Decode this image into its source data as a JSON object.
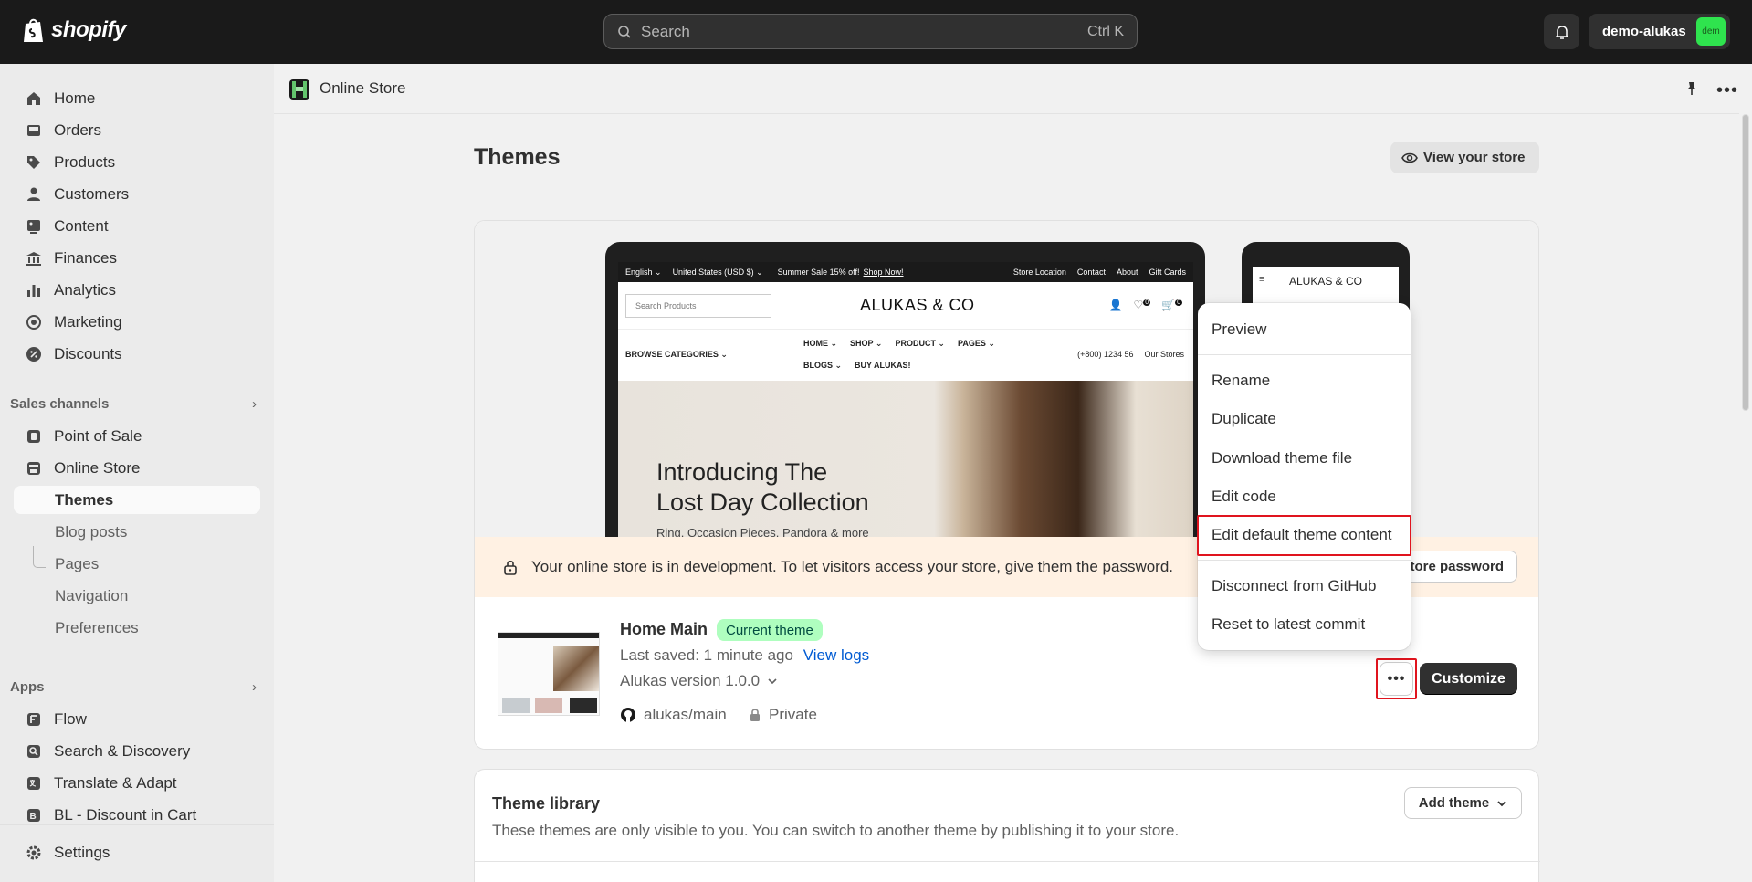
{
  "topbar": {
    "logo_text": "shopify",
    "search_placeholder": "Search",
    "search_shortcut": "Ctrl K",
    "account_name": "demo-alukas",
    "avatar_text": "dem"
  },
  "sidebar": {
    "main_items": [
      {
        "label": "Home",
        "icon": "home-icon"
      },
      {
        "label": "Orders",
        "icon": "inbox-icon"
      },
      {
        "label": "Products",
        "icon": "tag-icon"
      },
      {
        "label": "Customers",
        "icon": "person-icon"
      },
      {
        "label": "Content",
        "icon": "content-icon"
      },
      {
        "label": "Finances",
        "icon": "bank-icon"
      },
      {
        "label": "Analytics",
        "icon": "bar-chart-icon"
      },
      {
        "label": "Marketing",
        "icon": "target-icon"
      },
      {
        "label": "Discounts",
        "icon": "discount-icon"
      }
    ],
    "sales_channels_title": "Sales channels",
    "sales_channels": [
      {
        "label": "Point of Sale",
        "icon": "pos-icon"
      },
      {
        "label": "Online Store",
        "icon": "store-icon"
      }
    ],
    "online_store_sub": [
      {
        "label": "Themes",
        "active": true
      },
      {
        "label": "Blog posts"
      },
      {
        "label": "Pages"
      },
      {
        "label": "Navigation"
      },
      {
        "label": "Preferences"
      }
    ],
    "apps_title": "Apps",
    "apps": [
      {
        "label": "Flow",
        "icon": "flow-icon"
      },
      {
        "label": "Search & Discovery",
        "icon": "search-discovery-icon"
      },
      {
        "label": "Translate & Adapt",
        "icon": "translate-icon"
      },
      {
        "label": "BL - Discount in Cart",
        "icon": "bl-icon"
      }
    ],
    "settings_label": "Settings"
  },
  "page_header": {
    "title": "Online Store"
  },
  "themes_page": {
    "title": "Themes",
    "view_store_label": "View your store"
  },
  "preview": {
    "announce_lang": "English ⌄",
    "announce_currency": "United States (USD $) ⌄",
    "announce_sale": "Summer Sale 15% off!",
    "announce_shop": "Shop Now!",
    "announce_links": [
      "Store Location",
      "Contact",
      "About",
      "Gift Cards"
    ],
    "store_search_placeholder": "Search Products",
    "store_logo": "ALUKAS & CO",
    "browse_categories": "BROWSE CATEGORIES ⌄",
    "nav_links_row1": [
      "HOME ⌄",
      "SHOP ⌄",
      "PRODUCT ⌄",
      "PAGES ⌄"
    ],
    "nav_links_row2": [
      "BLOGS ⌄",
      "BUY ALUKAS!"
    ],
    "phone_number": "(+800) 1234 56",
    "our_stores": "Our Stores",
    "hero_title_line1": "Introducing The",
    "hero_title_line2": "Lost Day Collection",
    "hero_subtitle": "Ring, Occasion Pieces, Pandora & more",
    "phone_logo": "ALUKAS & CO",
    "cart_count": "0",
    "wishlist_count": "0"
  },
  "dev_banner": {
    "text": "Your online store is in development. To let visitors access your store, give them the password.",
    "button_label": "store password"
  },
  "current_theme": {
    "name": "Home Main",
    "badge": "Current theme",
    "last_saved": "Last saved: 1 minute ago",
    "view_logs": "View logs",
    "version": "Alukas version 1.0.0",
    "repo": "alukas/main",
    "visibility": "Private",
    "customize_label": "Customize",
    "more_label": "•••"
  },
  "actions_menu": {
    "items": [
      "Preview",
      "Rename",
      "Duplicate",
      "Download theme file",
      "Edit code",
      "Edit default theme content",
      "Disconnect from GitHub",
      "Reset to latest commit"
    ]
  },
  "theme_library": {
    "title": "Theme library",
    "description": "These themes are only visible to you. You can switch to another theme by publishing it to your store.",
    "add_theme_label": "Add theme"
  },
  "colors": {
    "topbar": "#1a1a1a",
    "sidebar": "#ebebeb",
    "badge_bg": "#affebf",
    "dev_banner_bg": "#fff1e3",
    "highlight": "#e0141e",
    "link": "#005bd3"
  }
}
